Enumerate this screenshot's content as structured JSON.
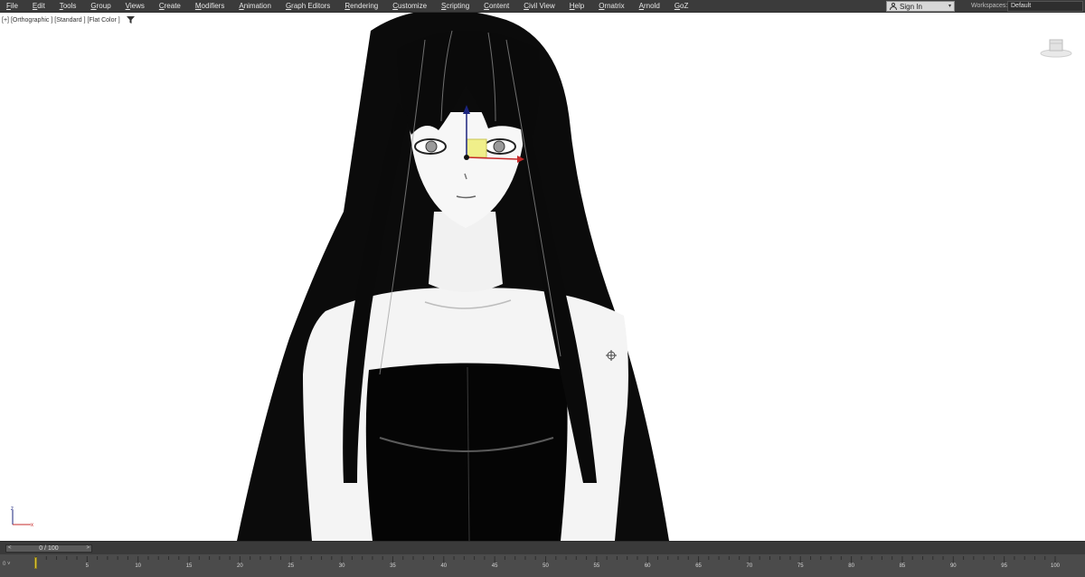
{
  "menu": {
    "items": [
      "File",
      "Edit",
      "Tools",
      "Group",
      "Views",
      "Create",
      "Modifiers",
      "Animation",
      "Graph Editors",
      "Rendering",
      "Customize",
      "Scripting",
      "Content",
      "Civil View",
      "Help",
      "Ornatrix",
      "Arnold",
      "GoZ"
    ]
  },
  "account": {
    "signin_label": "Sign In"
  },
  "workspaces": {
    "label": "Workspaces:",
    "selected": "Default"
  },
  "viewport": {
    "labels": [
      "[+]",
      "[Orthographic ]",
      "[Standard ]",
      "[Flat Color ]"
    ]
  },
  "timeline": {
    "slider_text": "0 / 100",
    "slider_prev": "<",
    "slider_next": ">",
    "start_marker": "0 ˅",
    "current_frame": 0,
    "total_frames": 100,
    "frame_labels": [
      "5",
      "10",
      "15",
      "20",
      "25",
      "30",
      "35",
      "40",
      "45",
      "50",
      "55",
      "60",
      "65",
      "70",
      "75",
      "80",
      "85",
      "90",
      "95",
      "100"
    ]
  },
  "colors": {
    "menu_bg": "#3b3b3b",
    "viewport_bg": "#ffffff",
    "timeline_bg": "#444444",
    "playhead": "#d8c33a",
    "gizmo_x": "#c62828",
    "gizmo_z": "#1a237e",
    "gizmo_plane": "#f0ef8a"
  }
}
